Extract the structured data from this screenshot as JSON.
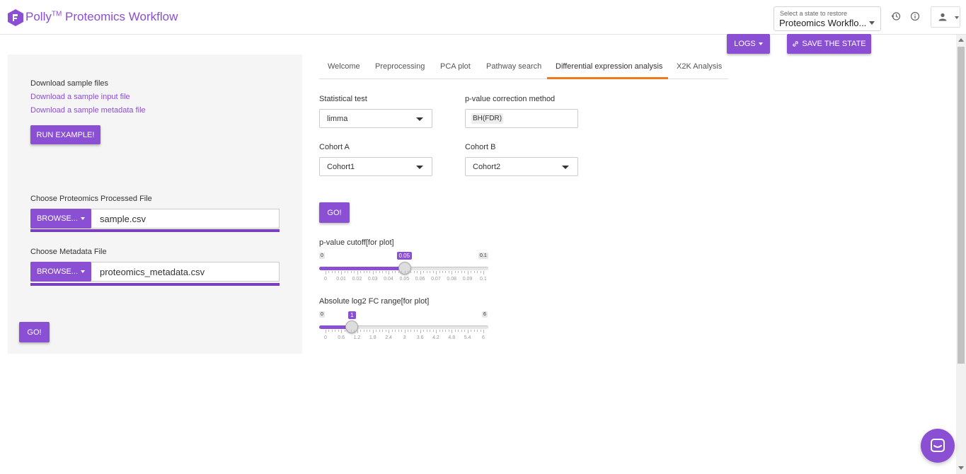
{
  "header": {
    "brand": "Polly",
    "tm": "TM",
    "title": " Proteomics Workflow",
    "state_select": {
      "label": "Select a state to restore",
      "value": "Proteomics Workflo..."
    }
  },
  "toolbar": {
    "logs_label": "LOGS",
    "save_label": "SAVE THE STATE"
  },
  "sidebar": {
    "download_heading": "Download sample files",
    "link_input": "Download a sample input file",
    "link_metadata": "Download a sample metadata file",
    "run_example": "RUN EXAMPLE!",
    "processed_label": "Choose Proteomics Processed File",
    "processed_browse": "BROWSE...",
    "processed_file": "sample.csv",
    "processed_progress": 1.0,
    "metadata_label": "Choose Metadata File",
    "metadata_browse": "BROWSE...",
    "metadata_file": "proteomics_metadata.csv",
    "metadata_progress": 1.0,
    "go": "GO!"
  },
  "tabs": [
    {
      "label": "Welcome",
      "active": false
    },
    {
      "label": "Preprocessing",
      "active": false
    },
    {
      "label": "PCA plot",
      "active": false
    },
    {
      "label": "Pathway search",
      "active": false
    },
    {
      "label": "Differential expression analysis",
      "active": true
    },
    {
      "label": "X2K Analysis",
      "active": false
    }
  ],
  "dea": {
    "stat_test_label": "Statistical test",
    "stat_test_value": "limma",
    "pcorr_label": "p-value correction method",
    "pcorr_value": "BH(FDR)",
    "cohort_a_label": "Cohort A",
    "cohort_a_value": "Cohort1",
    "cohort_b_label": "Cohort B",
    "cohort_b_value": "Cohort2",
    "go": "GO!",
    "pval_slider": {
      "label": "p-value cutoff[for plot]",
      "min": "0",
      "max": "0.1",
      "value": "0.05",
      "fraction": 0.5,
      "ticks": [
        "0",
        "0.01",
        "0.02",
        "0.03",
        "0.04",
        "0.05",
        "0.06",
        "0.07",
        "0.08",
        "0.09",
        "0.1"
      ]
    },
    "fc_slider": {
      "label": "Absolute log2 FC range[for plot]",
      "min": "0",
      "max": "6",
      "value": "1",
      "fraction": 0.1667,
      "ticks": [
        "0",
        "0.6",
        "1.2",
        "1.8",
        "2.4",
        "3",
        "3.6",
        "4.2",
        "4.8",
        "5.4",
        "6"
      ]
    }
  },
  "colors": {
    "accent": "#8a4fd3",
    "tab_indicator": "#f07a1b"
  }
}
